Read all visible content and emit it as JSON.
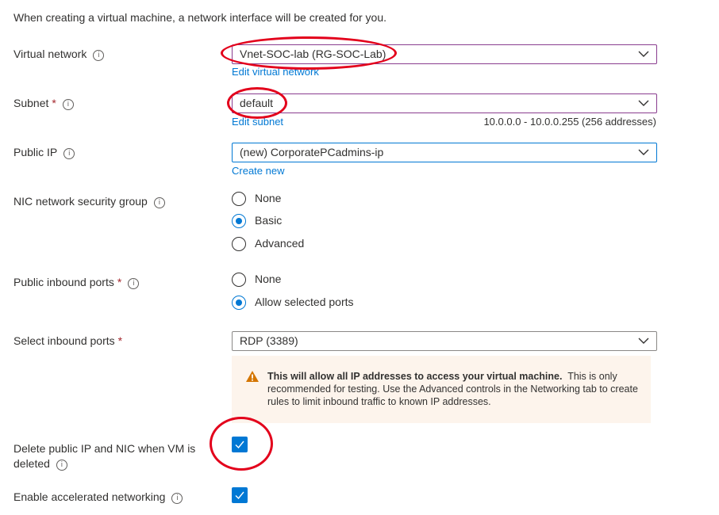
{
  "intro": "When creating a virtual machine, a network interface will be created for you.",
  "virtual_network": {
    "label": "Virtual network",
    "value": "Vnet-SOC-lab (RG-SOC-Lab)",
    "link": "Edit virtual network"
  },
  "subnet": {
    "label": "Subnet",
    "required": "*",
    "value": "default",
    "link": "Edit subnet",
    "range": "10.0.0.0 - 10.0.0.255 (256 addresses)"
  },
  "public_ip": {
    "label": "Public IP",
    "value": "(new) CorporatePCadmins-ip",
    "link": "Create new"
  },
  "nic_nsg": {
    "label": "NIC network security group",
    "options": [
      "None",
      "Basic",
      "Advanced"
    ],
    "selected": "Basic"
  },
  "public_inbound_ports": {
    "label": "Public inbound ports",
    "required": "*",
    "options": [
      "None",
      "Allow selected ports"
    ],
    "selected": "Allow selected ports"
  },
  "select_inbound_ports": {
    "label": "Select inbound ports",
    "required": "*",
    "value": "RDP (3389)"
  },
  "warning": {
    "bold": "This will allow all IP addresses to access your virtual machine.",
    "text": "This is only recommended for testing.  Use the Advanced controls in the Networking tab to create rules to limit inbound traffic to known IP addresses."
  },
  "delete_public_ip": {
    "label_line1": "Delete public IP and NIC when VM is",
    "label_line2": "deleted",
    "checked": true
  },
  "accelerated_networking": {
    "label": "Enable accelerated networking",
    "checked": true
  },
  "info_glyph": "i",
  "colors": {
    "accent": "#0078d4",
    "annotation": "#e3001b",
    "warning_bg": "#fdf4ec",
    "warning_icon": "#d47500",
    "required": "#a4262c"
  }
}
